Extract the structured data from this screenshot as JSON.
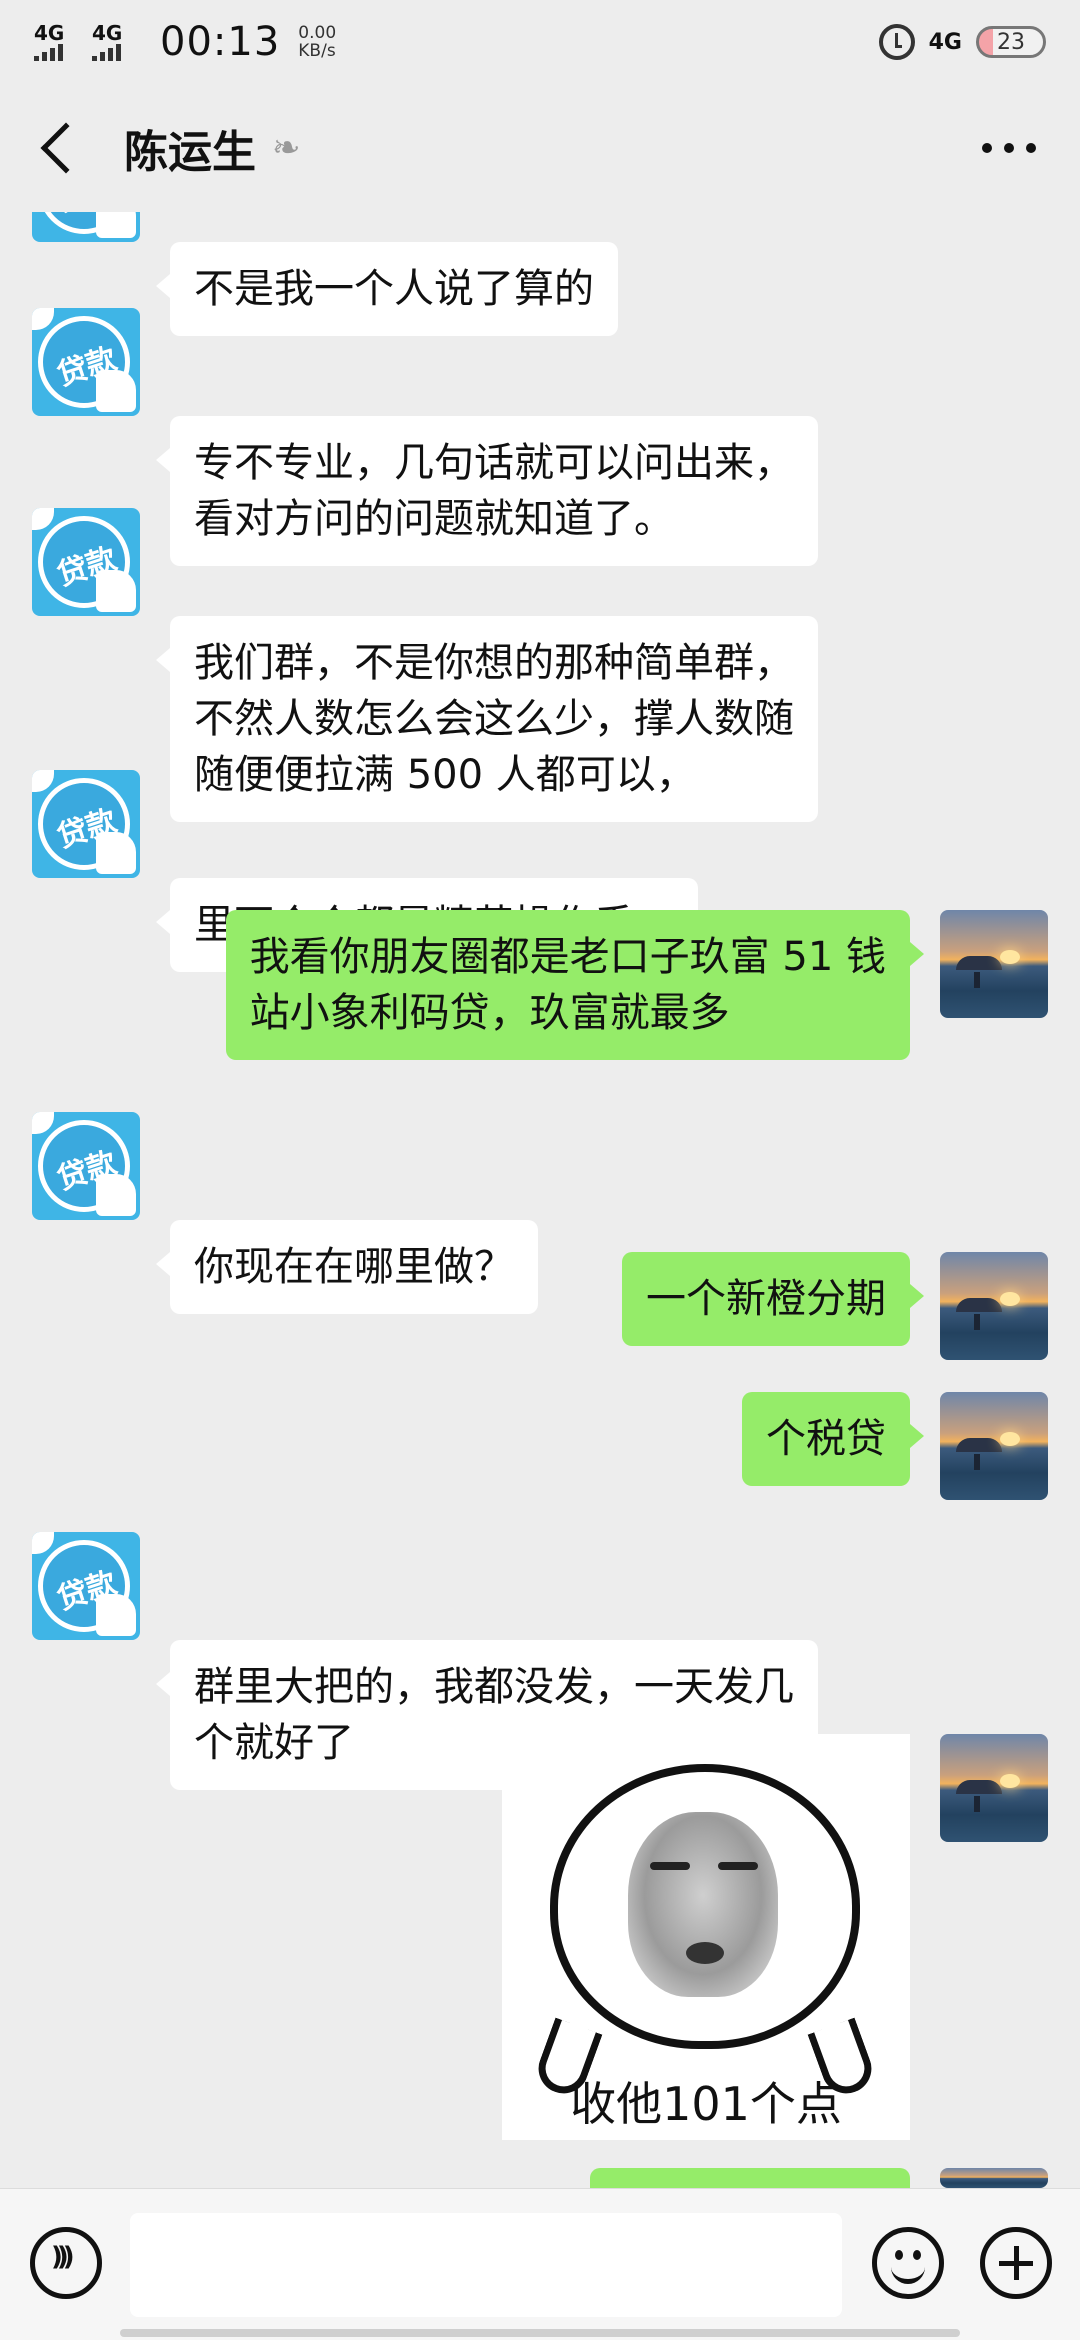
{
  "status_bar": {
    "signal1": "4G",
    "signal2": "4G",
    "time": "00:13",
    "net_speed_value": "0.00",
    "net_speed_unit": "KB/s",
    "right_network": "4G",
    "battery": "23"
  },
  "header": {
    "title": "陈运生"
  },
  "messages": [
    {
      "side": "in",
      "text": "不是我一个人说了算的"
    },
    {
      "side": "in",
      "text": "专不专业，几句话就可以问出来，\n看对方问的问题就知道了。"
    },
    {
      "side": "in",
      "text": "我们群，不是你想的那种简单群，\n不然人数怎么会这么少，撑人数随\n随便便拉满 500 人都可以，"
    },
    {
      "side": "in",
      "text": "里面个个都是精英操作手，"
    },
    {
      "side": "out",
      "text": "我看你朋友圈都是老口子玖富 51 钱\n站小象利码贷，玖富就最多"
    },
    {
      "side": "in",
      "text": "你现在在哪里做？"
    },
    {
      "side": "out",
      "text": "一个新橙分期"
    },
    {
      "side": "out",
      "text": "个税贷"
    },
    {
      "side": "in",
      "text": "群里大把的，我都没发，一天发几\n个就好了"
    },
    {
      "side": "out",
      "sticker_caption": "收他101个点"
    }
  ],
  "avatars": {
    "contact_avatar_text": "贷款"
  }
}
